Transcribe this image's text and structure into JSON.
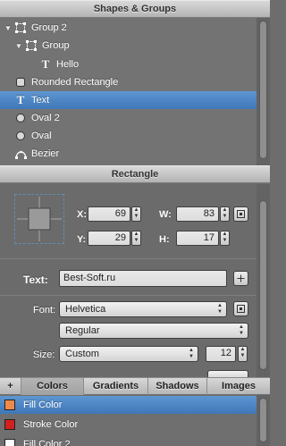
{
  "shapes_panel": {
    "title": "Shapes & Groups",
    "layers": [
      {
        "label": "Group 2",
        "icon": "group-icon",
        "expanded": true,
        "indent": 0
      },
      {
        "label": "Group",
        "icon": "group-icon",
        "expanded": true,
        "indent": 1
      },
      {
        "label": "Hello",
        "icon": "text-icon",
        "indent": 2
      },
      {
        "label": "Rounded Rectangle",
        "icon": "rounded-rect-icon",
        "indent": 0
      },
      {
        "label": "Text",
        "icon": "text-icon",
        "indent": 0,
        "selected": true
      },
      {
        "label": "Oval 2",
        "icon": "oval-icon",
        "indent": 0
      },
      {
        "label": "Oval",
        "icon": "oval-icon",
        "indent": 0
      },
      {
        "label": "Bezier",
        "icon": "bezier-icon",
        "indent": 0
      }
    ]
  },
  "inspector": {
    "title": "Rectangle",
    "geometry": {
      "x_label": "X:",
      "x_value": "69",
      "y_label": "Y:",
      "y_value": "29",
      "w_label": "W:",
      "w_value": "83",
      "h_label": "H:",
      "h_value": "17"
    },
    "text": {
      "label": "Text:",
      "value": "Best-Soft.ru",
      "font_label": "Font:",
      "font_value": "Helvetica",
      "style_value": "Regular",
      "size_label": "Size:",
      "size_value": "Custom",
      "size_number": "12"
    }
  },
  "tabs": {
    "add_label": "+",
    "items": [
      "Colors",
      "Gradients",
      "Shadows",
      "Images"
    ],
    "active": "Colors"
  },
  "colors": [
    {
      "label": "Fill Color",
      "color": "#f08a4b",
      "selected": true
    },
    {
      "label": "Stroke Color",
      "color": "#d21f1f"
    },
    {
      "label": "Fill Color 2",
      "color": "#ffffff"
    }
  ]
}
